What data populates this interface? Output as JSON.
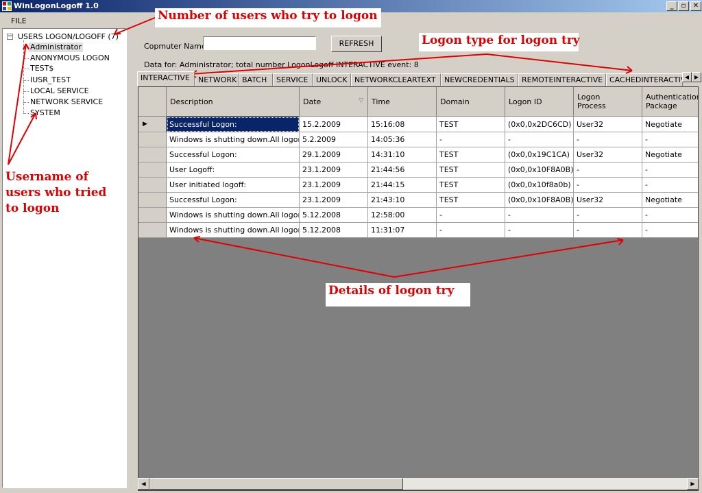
{
  "window": {
    "title": "WinLogonLogoff 1.0",
    "btn_minimize": "_",
    "btn_maximize": "▫",
    "btn_close": "✕"
  },
  "menu": {
    "file": "FILE"
  },
  "tree": {
    "expander": "−",
    "root": "USERS LOGON/LOGOFF (7)",
    "users": [
      "Administrator",
      "ANONYMOUS LOGON",
      "TEST$",
      "IUSR_TEST",
      "LOCAL SERVICE",
      "NETWORK SERVICE",
      "SYSTEM"
    ]
  },
  "toolbar": {
    "computer_label": "Copmuter Name",
    "computer_value": "",
    "refresh": "REFRESH"
  },
  "info": "Data for: Administrator; total number LogonLogoff INTERACTIVE event: 8",
  "tabs": [
    "INTERACTIVE",
    "NETWORK",
    "BATCH",
    "SERVICE",
    "UNLOCK",
    "NETWORKCLEARTEXT",
    "NEWCREDENTIALS",
    "REMOTEINTERACTIVE",
    "CACHEDINTERACTIVE"
  ],
  "tab_scroll": {
    "left": "◀",
    "right": "▶"
  },
  "grid": {
    "headers": [
      "Description",
      "Date",
      "Time",
      "Domain",
      "Logon ID",
      "Logon\nProcess",
      "Authentication\nPackage"
    ],
    "sort_glyph": "▽",
    "current_row_glyph": "▶",
    "rows": [
      [
        "Successful Logon:",
        "15.2.2009",
        "15:16:08",
        "TEST",
        "(0x0,0x2DC6CD)",
        "User32",
        "Negotiate"
      ],
      [
        "Windows is shutting down.All logon s...",
        "5.2.2009",
        "14:05:36",
        "-",
        "-",
        "-",
        "-"
      ],
      [
        "Successful Logon:",
        "29.1.2009",
        "14:31:10",
        "TEST",
        "(0x0,0x19C1CA)",
        "User32",
        "Negotiate"
      ],
      [
        "User Logoff:",
        "23.1.2009",
        "21:44:56",
        "TEST",
        "(0x0,0x10F8A0B)",
        "-",
        "-"
      ],
      [
        "User initiated logoff:",
        "23.1.2009",
        "21:44:15",
        "TEST",
        "(0x0,0x10f8a0b)",
        "-",
        "-"
      ],
      [
        "Successful Logon:",
        "23.1.2009",
        "21:43:10",
        "TEST",
        "(0x0,0x10F8A0B)",
        "User32",
        "Negotiate"
      ],
      [
        "Windows is shutting down.All logon s...",
        "5.12.2008",
        "12:58:00",
        "-",
        "-",
        "-",
        "-"
      ],
      [
        "Windows is shutting down.All logon s...",
        "5.12.2008",
        "11:31:07",
        "-",
        "-",
        "-",
        "-"
      ]
    ]
  },
  "hscroll": {
    "left": "◀",
    "right": "▶"
  },
  "annotations": {
    "users_count": "Number of users who try to logon",
    "logon_type": "Logon type for logon try",
    "usernames": "Username of users who tried to logon",
    "details": "Details of logon try"
  },
  "colors": {
    "annotation": "#e00000",
    "selection": "#0a246a",
    "grid_background": "#808080"
  }
}
